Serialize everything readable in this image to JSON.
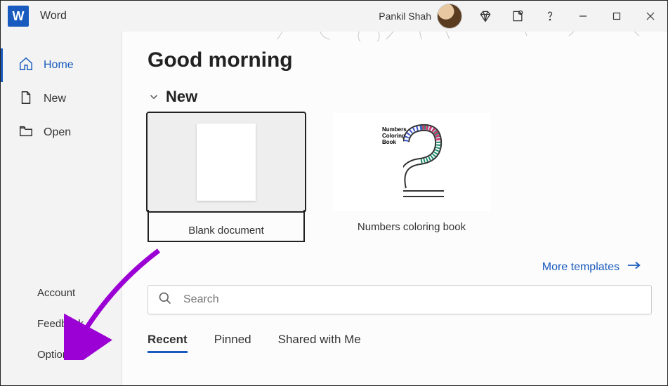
{
  "app": {
    "name": "Word"
  },
  "user": {
    "name": "Pankil Shah"
  },
  "sidebar": {
    "items": [
      {
        "label": "Home",
        "icon": "home",
        "active": true
      },
      {
        "label": "New",
        "icon": "document"
      },
      {
        "label": "Open",
        "icon": "folder"
      }
    ],
    "secondary": [
      {
        "label": "Account"
      },
      {
        "label": "Feedback"
      },
      {
        "label": "Options"
      }
    ]
  },
  "main": {
    "greeting": "Good morning",
    "section_new": "New",
    "templates": [
      {
        "label": "Blank document"
      },
      {
        "label": "Numbers coloring book",
        "thumb_text": "Numbers Coloring Book"
      }
    ],
    "more_templates": "More templates",
    "search_placeholder": "Search",
    "tabs": [
      {
        "label": "Recent",
        "active": true
      },
      {
        "label": "Pinned"
      },
      {
        "label": "Shared with Me"
      }
    ]
  }
}
